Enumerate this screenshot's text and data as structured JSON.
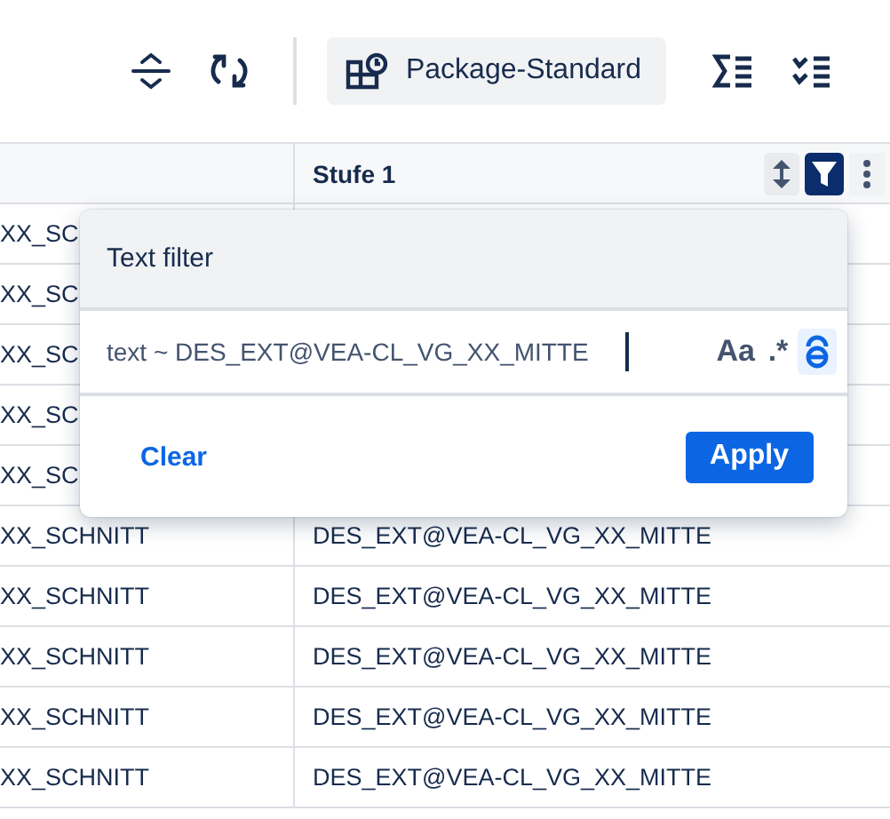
{
  "toolbar": {
    "view_button": {
      "label": "Package-Standard"
    }
  },
  "table": {
    "columns": [
      {
        "label": "Stufe 1",
        "filter_active": true
      }
    ],
    "rows": [
      {
        "column_1": "XX_SC"
      },
      {
        "column_1": "XX_SC"
      },
      {
        "column_1": "XX_SC"
      },
      {
        "column_1": "XX_SC"
      },
      {
        "column_1": "XX_SC"
      },
      {
        "column_1": "XX_SCHNITT",
        "column_2": "DES_EXT@VEA-CL_VG_XX_MITTE"
      },
      {
        "column_1": "XX_SCHNITT",
        "column_2": "DES_EXT@VEA-CL_VG_XX_MITTE"
      },
      {
        "column_1": "XX_SCHNITT",
        "column_2": "DES_EXT@VEA-CL_VG_XX_MITTE"
      },
      {
        "column_1": "XX_SCHNITT",
        "column_2": "DES_EXT@VEA-CL_VG_XX_MITTE"
      },
      {
        "column_1": "XX_SCHNITT",
        "column_2": "DES_EXT@VEA-CL_VG_XX_MITTE"
      }
    ]
  },
  "filter_popup": {
    "title": "Text filter",
    "value": "text ~ DES_EXT@VEA-CL_VG_XX_MITTE",
    "options": [
      {
        "kind": "text",
        "label": "Aa",
        "selected": false
      },
      {
        "kind": "text",
        "label": ".*",
        "selected": false
      },
      {
        "kind": "icon",
        "selected": true
      }
    ],
    "clear_label": "Clear",
    "apply_label": "Apply"
  }
}
